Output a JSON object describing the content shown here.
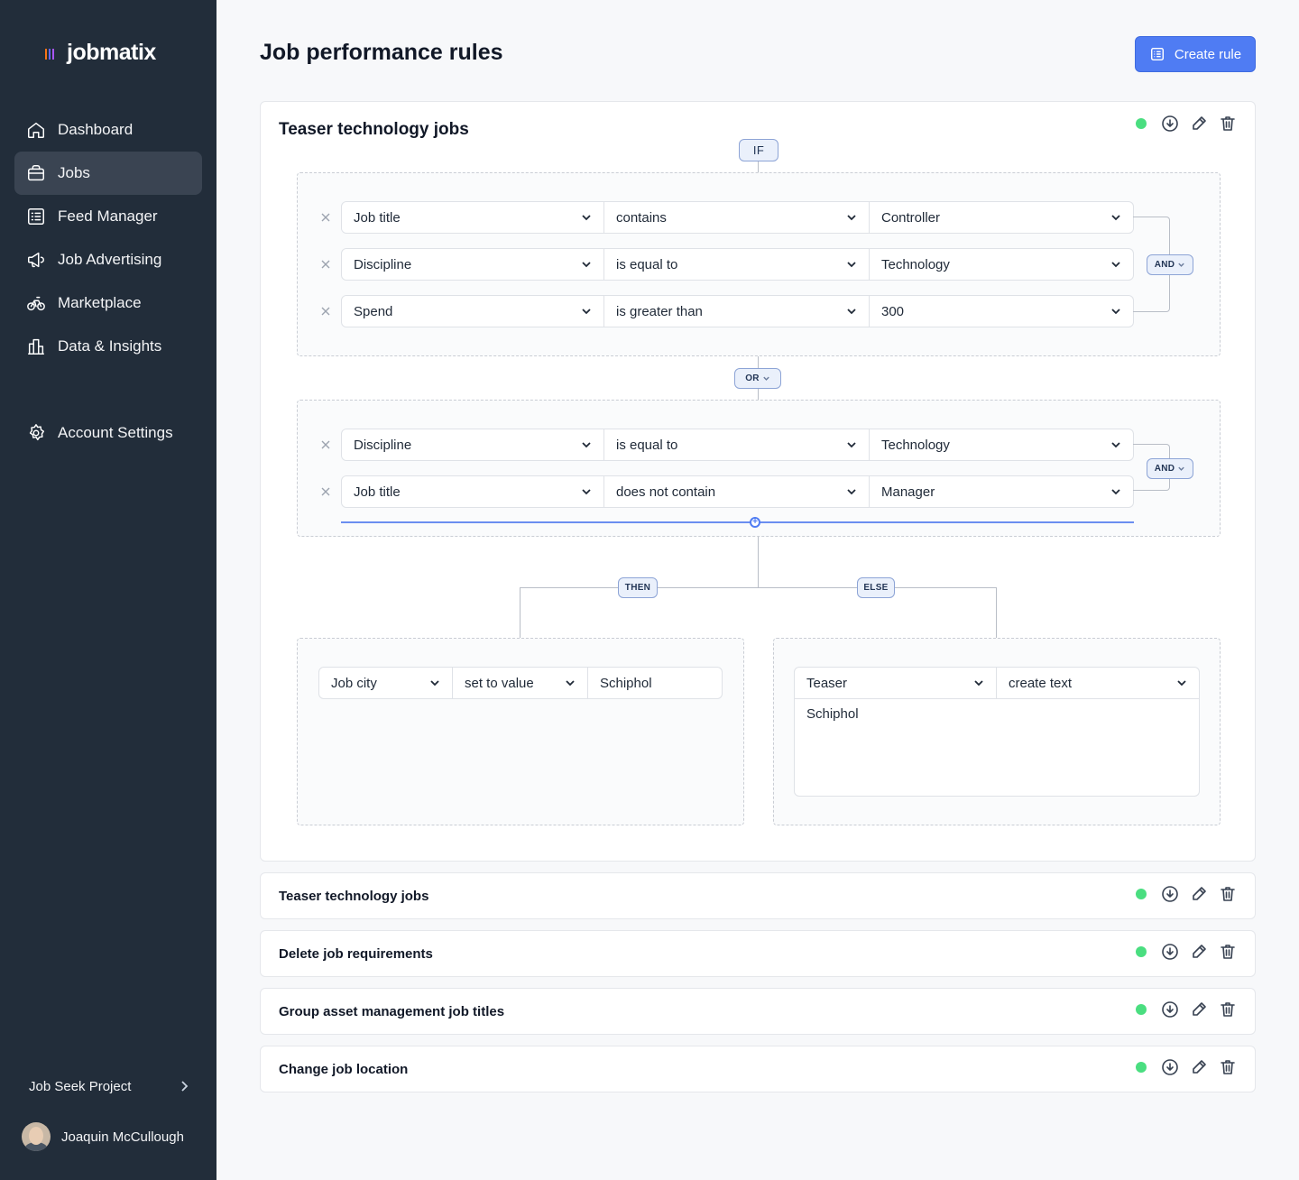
{
  "brand": {
    "name": "jobmatix",
    "bar_colors": [
      "#f97316",
      "#6366f1",
      "#a855f7"
    ]
  },
  "sidebar": {
    "items": [
      {
        "label": "Dashboard",
        "icon": "home-icon",
        "active": false
      },
      {
        "label": "Jobs",
        "icon": "briefcase-icon",
        "active": true
      },
      {
        "label": "Feed Manager",
        "icon": "list-icon",
        "active": false
      },
      {
        "label": "Job Advertising",
        "icon": "megaphone-icon",
        "active": false
      },
      {
        "label": "Marketplace",
        "icon": "bike-icon",
        "active": false
      },
      {
        "label": "Data & Insights",
        "icon": "chart-icon",
        "active": false
      }
    ],
    "account_settings": "Account Settings",
    "project": "Job Seek Project",
    "user_name": "Joaquin McCullough"
  },
  "page": {
    "title": "Job performance rules",
    "create_button": "Create rule"
  },
  "rule": {
    "title": "Teaser technology jobs",
    "if_label": "IF",
    "group1": {
      "operator": "AND",
      "conditions": [
        {
          "field": "Job title",
          "op": "contains",
          "value": "Controller"
        },
        {
          "field": "Discipline",
          "op": "is equal to",
          "value": "Technology"
        },
        {
          "field": "Spend",
          "op": "is greater than",
          "value": "300"
        }
      ]
    },
    "group_join": "OR",
    "group2": {
      "operator": "AND",
      "conditions": [
        {
          "field": "Discipline",
          "op": "is equal to",
          "value": "Technology"
        },
        {
          "field": "Job title",
          "op": "does not contain",
          "value": "Manager"
        }
      ]
    },
    "then_label": "THEN",
    "else_label": "ELSE",
    "then_action": {
      "field": "Job city",
      "op": "set to value",
      "value": "Schiphol"
    },
    "else_action": {
      "field": "Teaser",
      "op": "create text",
      "text": "Schiphol"
    }
  },
  "other_rules": [
    {
      "title": "Teaser technology jobs"
    },
    {
      "title": "Delete job requirements"
    },
    {
      "title": "Group asset management job titles"
    },
    {
      "title": "Change job location"
    }
  ],
  "colors": {
    "sidebar_bg": "#222d3a",
    "accent": "#4f7cf3",
    "status_active": "#4ade80"
  }
}
